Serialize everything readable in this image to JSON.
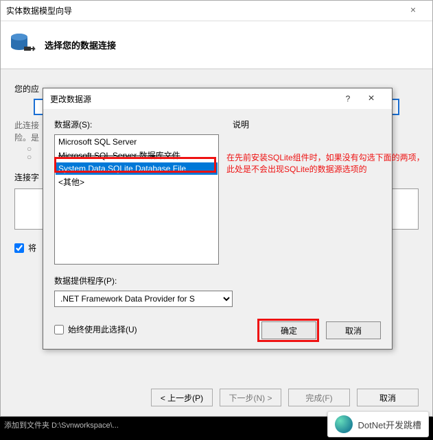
{
  "main": {
    "title": "实体数据模型向导",
    "wizard_title": "选择您的数据连接",
    "app_label_prefix": "您的应",
    "hint_line1": "此连接",
    "hint_line2": "险。是",
    "conn_label": "连接字",
    "save_check_label": "将",
    "back_btn": "< 上一步(P)",
    "next_btn": "下一步(N) >",
    "finish_btn": "完成(F)",
    "cancel_btn": "取消"
  },
  "sub": {
    "title": "更改数据源",
    "help": "?",
    "close": "×",
    "ds_label": "数据源(S):",
    "desc_label": "说明",
    "items": [
      "Microsoft SQL Server",
      "Microsoft SQL Server 数据库文件",
      "System.Data.SQLite Database File",
      "<其他>"
    ],
    "provider_label": "数据提供程序(P):",
    "provider_value": ".NET Framework Data Provider for S",
    "always_label": "始终使用此选择(U)",
    "ok_btn": "确定",
    "cancel_btn": "取消"
  },
  "annotation": {
    "line1": "在先前安装SQLite组件时，如果没有勾选下面的两项，",
    "line2": "此处是不会出现SQLite的数据源选项的"
  },
  "footer_brand": "DotNet开发跳槽",
  "blackbar": "添加到文件夹  D:\\Svnworkspace\\..."
}
